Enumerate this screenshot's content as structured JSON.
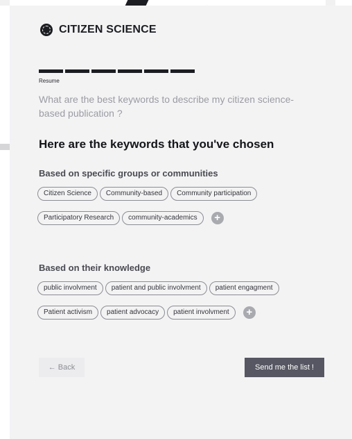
{
  "brand": {
    "name": "CITIZEN SCIENCE",
    "logo_icon": "globe-icon"
  },
  "progress": {
    "completed_steps": 6,
    "total_steps": 6,
    "step_label": "Resume"
  },
  "question": "What are the best keywords to describe my citizen science-based publication ?",
  "heading": "Here are the keywords that you've chosen",
  "groups": [
    {
      "title": "Based on specific groups or communities",
      "rows": [
        [
          "Citizen Science",
          "Community-based",
          "Community participation"
        ],
        [
          "Participatory Research",
          "community-academics"
        ]
      ],
      "add_label": "+"
    },
    {
      "title": "Based on their knowledge",
      "rows": [
        [
          "public involvment",
          "patient and public involvment",
          "patient engagment"
        ],
        [
          "Patient activism",
          "patient advocacy",
          "patient involvment"
        ]
      ],
      "add_label": "+"
    }
  ],
  "actions": {
    "back_label": "← Back",
    "send_label": "Send me the list !"
  },
  "colors": {
    "card_bg": "#f3f3f4",
    "primary_dark": "#1c1d22",
    "send_button": "#565762",
    "add_button": "#a9aaaf"
  }
}
